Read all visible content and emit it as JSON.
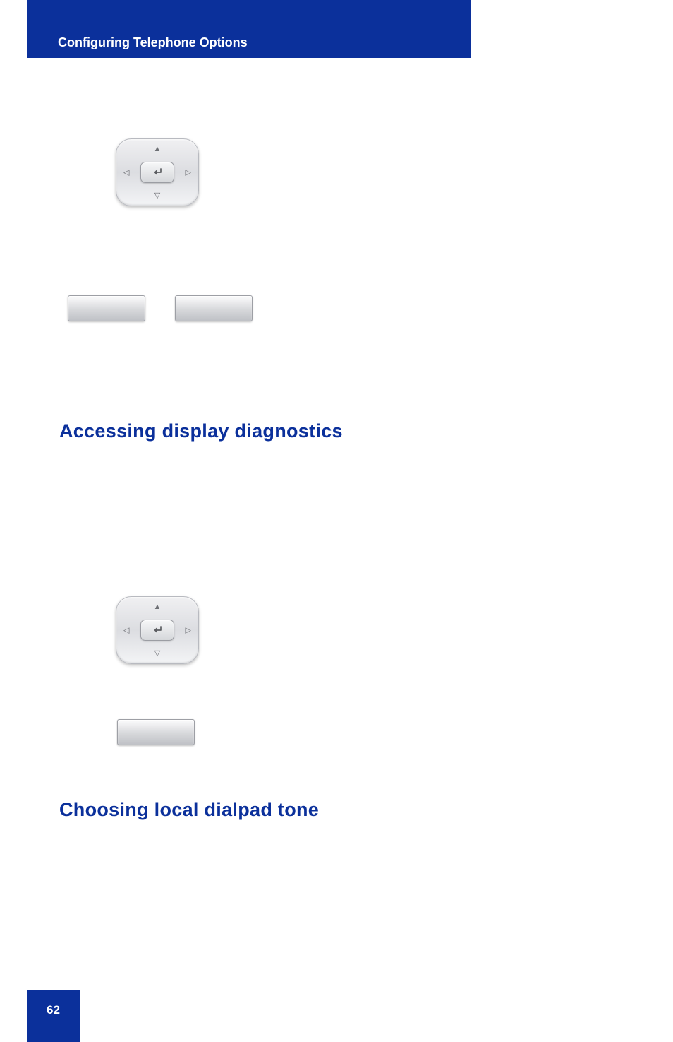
{
  "header": {
    "title": "Configuring Telephone Options"
  },
  "icons": {
    "navpad1": "navigation-pad",
    "navpad2": "navigation-pad",
    "softkeyLeft": "",
    "softkeyRight": "",
    "softkeySingle": ""
  },
  "headings": {
    "diagnostics": "Accessing display diagnostics",
    "dialpadTone": "Choosing local dialpad tone"
  },
  "footer": {
    "pageNumber": "62"
  }
}
